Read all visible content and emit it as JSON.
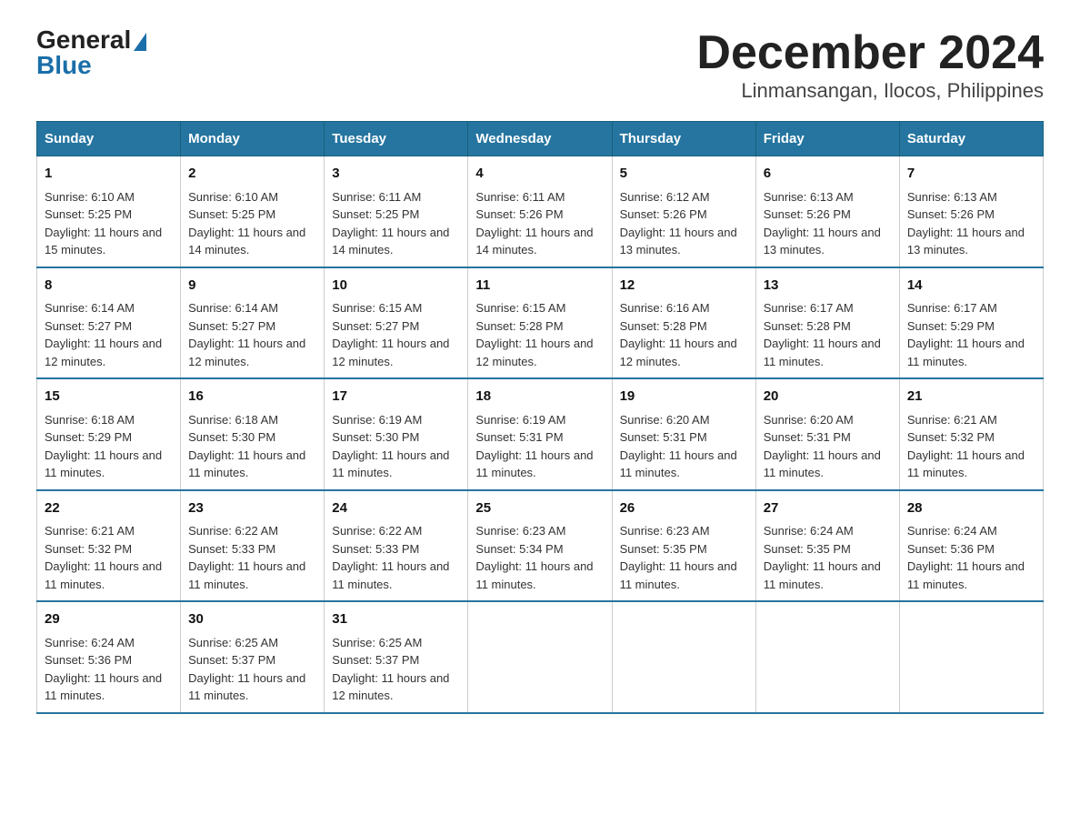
{
  "logo": {
    "general": "General",
    "blue": "Blue"
  },
  "title": "December 2024",
  "subtitle": "Linmansangan, Ilocos, Philippines",
  "days_of_week": [
    "Sunday",
    "Monday",
    "Tuesday",
    "Wednesday",
    "Thursday",
    "Friday",
    "Saturday"
  ],
  "weeks": [
    [
      {
        "day": "1",
        "sunrise": "6:10 AM",
        "sunset": "5:25 PM",
        "daylight": "11 hours and 15 minutes."
      },
      {
        "day": "2",
        "sunrise": "6:10 AM",
        "sunset": "5:25 PM",
        "daylight": "11 hours and 14 minutes."
      },
      {
        "day": "3",
        "sunrise": "6:11 AM",
        "sunset": "5:25 PM",
        "daylight": "11 hours and 14 minutes."
      },
      {
        "day": "4",
        "sunrise": "6:11 AM",
        "sunset": "5:26 PM",
        "daylight": "11 hours and 14 minutes."
      },
      {
        "day": "5",
        "sunrise": "6:12 AM",
        "sunset": "5:26 PM",
        "daylight": "11 hours and 13 minutes."
      },
      {
        "day": "6",
        "sunrise": "6:13 AM",
        "sunset": "5:26 PM",
        "daylight": "11 hours and 13 minutes."
      },
      {
        "day": "7",
        "sunrise": "6:13 AM",
        "sunset": "5:26 PM",
        "daylight": "11 hours and 13 minutes."
      }
    ],
    [
      {
        "day": "8",
        "sunrise": "6:14 AM",
        "sunset": "5:27 PM",
        "daylight": "11 hours and 12 minutes."
      },
      {
        "day": "9",
        "sunrise": "6:14 AM",
        "sunset": "5:27 PM",
        "daylight": "11 hours and 12 minutes."
      },
      {
        "day": "10",
        "sunrise": "6:15 AM",
        "sunset": "5:27 PM",
        "daylight": "11 hours and 12 minutes."
      },
      {
        "day": "11",
        "sunrise": "6:15 AM",
        "sunset": "5:28 PM",
        "daylight": "11 hours and 12 minutes."
      },
      {
        "day": "12",
        "sunrise": "6:16 AM",
        "sunset": "5:28 PM",
        "daylight": "11 hours and 12 minutes."
      },
      {
        "day": "13",
        "sunrise": "6:17 AM",
        "sunset": "5:28 PM",
        "daylight": "11 hours and 11 minutes."
      },
      {
        "day": "14",
        "sunrise": "6:17 AM",
        "sunset": "5:29 PM",
        "daylight": "11 hours and 11 minutes."
      }
    ],
    [
      {
        "day": "15",
        "sunrise": "6:18 AM",
        "sunset": "5:29 PM",
        "daylight": "11 hours and 11 minutes."
      },
      {
        "day": "16",
        "sunrise": "6:18 AM",
        "sunset": "5:30 PM",
        "daylight": "11 hours and 11 minutes."
      },
      {
        "day": "17",
        "sunrise": "6:19 AM",
        "sunset": "5:30 PM",
        "daylight": "11 hours and 11 minutes."
      },
      {
        "day": "18",
        "sunrise": "6:19 AM",
        "sunset": "5:31 PM",
        "daylight": "11 hours and 11 minutes."
      },
      {
        "day": "19",
        "sunrise": "6:20 AM",
        "sunset": "5:31 PM",
        "daylight": "11 hours and 11 minutes."
      },
      {
        "day": "20",
        "sunrise": "6:20 AM",
        "sunset": "5:31 PM",
        "daylight": "11 hours and 11 minutes."
      },
      {
        "day": "21",
        "sunrise": "6:21 AM",
        "sunset": "5:32 PM",
        "daylight": "11 hours and 11 minutes."
      }
    ],
    [
      {
        "day": "22",
        "sunrise": "6:21 AM",
        "sunset": "5:32 PM",
        "daylight": "11 hours and 11 minutes."
      },
      {
        "day": "23",
        "sunrise": "6:22 AM",
        "sunset": "5:33 PM",
        "daylight": "11 hours and 11 minutes."
      },
      {
        "day": "24",
        "sunrise": "6:22 AM",
        "sunset": "5:33 PM",
        "daylight": "11 hours and 11 minutes."
      },
      {
        "day": "25",
        "sunrise": "6:23 AM",
        "sunset": "5:34 PM",
        "daylight": "11 hours and 11 minutes."
      },
      {
        "day": "26",
        "sunrise": "6:23 AM",
        "sunset": "5:35 PM",
        "daylight": "11 hours and 11 minutes."
      },
      {
        "day": "27",
        "sunrise": "6:24 AM",
        "sunset": "5:35 PM",
        "daylight": "11 hours and 11 minutes."
      },
      {
        "day": "28",
        "sunrise": "6:24 AM",
        "sunset": "5:36 PM",
        "daylight": "11 hours and 11 minutes."
      }
    ],
    [
      {
        "day": "29",
        "sunrise": "6:24 AM",
        "sunset": "5:36 PM",
        "daylight": "11 hours and 11 minutes."
      },
      {
        "day": "30",
        "sunrise": "6:25 AM",
        "sunset": "5:37 PM",
        "daylight": "11 hours and 11 minutes."
      },
      {
        "day": "31",
        "sunrise": "6:25 AM",
        "sunset": "5:37 PM",
        "daylight": "11 hours and 12 minutes."
      },
      null,
      null,
      null,
      null
    ]
  ],
  "labels": {
    "sunrise_prefix": "Sunrise: ",
    "sunset_prefix": "Sunset: ",
    "daylight_prefix": "Daylight: "
  }
}
